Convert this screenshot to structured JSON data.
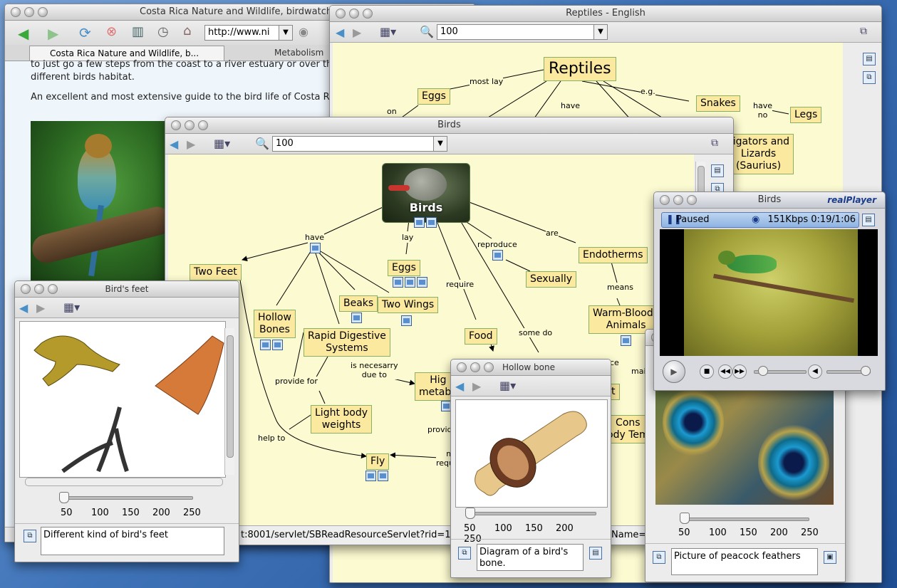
{
  "browser": {
    "title": "Costa Rica Nature and Wildlife, birdwatchin",
    "url": "http://www.ni",
    "tab_active": "Costa Rica Nature and Wildlife, b...",
    "tab_other": "Metabolism",
    "text1": "to just go a few steps from the coast to a river estuary or over the nex",
    "text2": "different birds habitat.",
    "text3": "An excellent and most extensive guide to the bird life of Costa Rica is \"",
    "status": "t:8001/servlet/SBReadResourceServlet?rid=113(",
    "status2": "Name="
  },
  "reptiles": {
    "title": "Reptiles - English",
    "zoom": "100",
    "concepts": {
      "reptiles": "Reptiles",
      "eggs": "Eggs",
      "snakes": "Snakes",
      "legs": "Legs",
      "alligators": "lligators and\nLizards\n(Saurius)"
    },
    "links": {
      "most_lay": "most lay",
      "eg": "e.g.",
      "have": "have",
      "have_no": "have\nno",
      "on": "on"
    }
  },
  "birds": {
    "title": "Birds",
    "zoom": "100",
    "concepts": {
      "birds": "Birds",
      "two_feet": "Two Feet",
      "eggs": "Eggs",
      "sexually": "Sexually",
      "endotherms": "Endotherms",
      "hollow_bones": "Hollow\nBones",
      "beaks": "Beaks",
      "two_wings": "Two Wings",
      "rapid_digestive": "Rapid Digestive\nSystems",
      "food": "Food",
      "warm_blooded": "Warm-Bloode\nAnimals",
      "high_metab": "Hig\nmetabo",
      "light_body": "Light body\nweights",
      "fly": "Fly",
      "const_body": "Cons\nody Tem",
      "t_partial": "t"
    },
    "links": {
      "have": "have",
      "lay": "lay",
      "reproduce": "reproduce",
      "are": "are",
      "require": "require",
      "means": "means",
      "some_do": "some do",
      "is_necesary": "is necesarry\ndue to",
      "provide_for": "provide for",
      "help_to": "help to",
      "provid": "provid",
      "m_requ": "m\nrequ",
      "ce": "ce",
      "mai": "mai"
    }
  },
  "feet": {
    "title": "Bird's feet",
    "ticks": [
      "50",
      "100",
      "150",
      "200",
      "250"
    ],
    "slider_value": 50,
    "caption": "Different kind of bird's feet"
  },
  "realplayer": {
    "title": "Birds",
    "brand": "realPlayer",
    "status": "Paused",
    "rate": "151Kbps 0:19/1:06"
  },
  "hollow": {
    "title": "Hollow bone",
    "ticks": [
      "50",
      "100",
      "150",
      "200",
      "250"
    ],
    "caption": "Diagram of a bird's\nbone."
  },
  "peacock": {
    "ticks": [
      "50",
      "100",
      "150",
      "200",
      "250"
    ],
    "caption": "Picture of peacock feathers"
  }
}
